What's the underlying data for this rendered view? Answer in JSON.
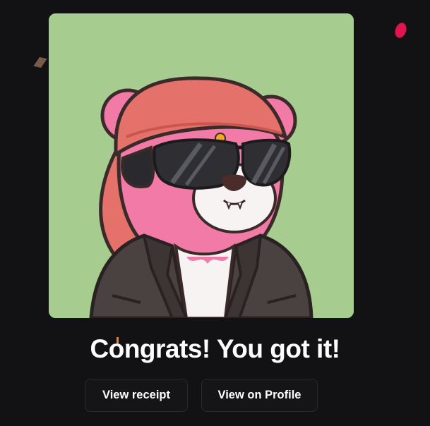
{
  "nft": {
    "image_description_name": "bear-nft-image"
  },
  "message": {
    "headline": "Congrats! You got it!"
  },
  "actions": {
    "view_receipt_label": "View receipt",
    "view_profile_label": "View on Profile"
  },
  "colors": {
    "background": "#121214",
    "card_background": "#a6cd8f",
    "bear_pink": "#f27aa6",
    "bandana": "#e4716a",
    "jacket": "#4a4240",
    "confetti_pink": "#e0144f",
    "confetti_orange": "#ff7a1a"
  }
}
